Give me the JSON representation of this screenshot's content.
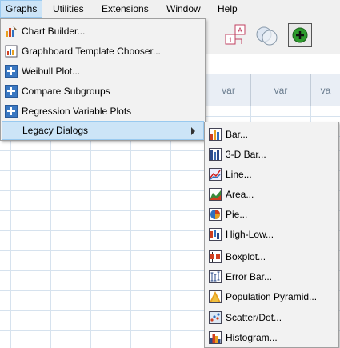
{
  "menubar": {
    "items": [
      {
        "label": "Graphs"
      },
      {
        "label": "Utilities"
      },
      {
        "label": "Extensions"
      },
      {
        "label": "Window"
      },
      {
        "label": "Help"
      }
    ]
  },
  "spreadsheet": {
    "column_headers": [
      "var",
      "var",
      "va"
    ]
  },
  "graphs_menu": {
    "items": [
      {
        "label": "Chart Builder...",
        "icon": "chart-builder-icon"
      },
      {
        "label": "Graphboard Template Chooser...",
        "icon": "graphboard-icon"
      },
      {
        "label": "Weibull Plot...",
        "icon": "plus-icon"
      },
      {
        "label": "Compare Subgroups",
        "icon": "plus-icon"
      },
      {
        "label": "Regression Variable Plots",
        "icon": "plus-icon"
      },
      {
        "label": "Legacy Dialogs",
        "icon": ""
      }
    ]
  },
  "legacy_menu": {
    "items": [
      {
        "label": "Bar...",
        "icon": "bar-chart-icon"
      },
      {
        "label": "3-D Bar...",
        "icon": "3d-bar-icon"
      },
      {
        "label": "Line...",
        "icon": "line-chart-icon"
      },
      {
        "label": "Area...",
        "icon": "area-chart-icon"
      },
      {
        "label": "Pie...",
        "icon": "pie-chart-icon"
      },
      {
        "label": "High-Low...",
        "icon": "high-low-icon"
      },
      {
        "label": "Boxplot...",
        "icon": "boxplot-icon"
      },
      {
        "label": "Error Bar...",
        "icon": "error-bar-icon"
      },
      {
        "label": "Population Pyramid...",
        "icon": "population-pyramid-icon"
      },
      {
        "label": "Scatter/Dot...",
        "icon": "scatter-icon"
      },
      {
        "label": "Histogram...",
        "icon": "histogram-icon"
      }
    ]
  }
}
